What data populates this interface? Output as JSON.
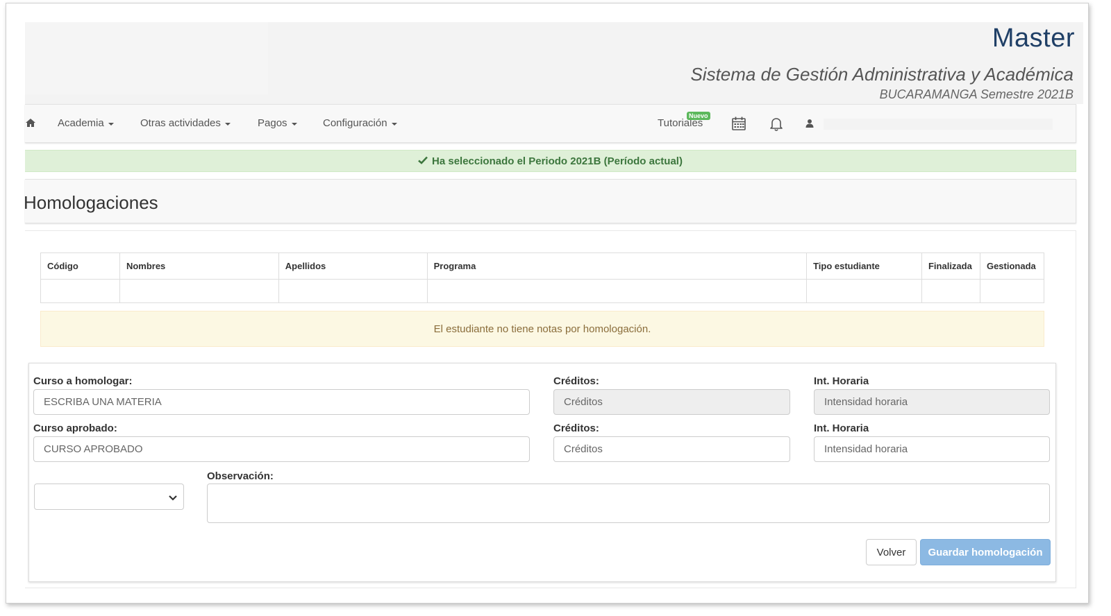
{
  "brand": {
    "title": "Master",
    "subtitle": "Sistema de Gestión Administrativa y Académica",
    "campus": "BUCARAMANGA Semestre 2021B"
  },
  "nav": {
    "home_icon": "home-icon",
    "items": [
      {
        "label": "Academia"
      },
      {
        "label": "Otras actividades"
      },
      {
        "label": "Pagos"
      },
      {
        "label": "Configuración"
      }
    ],
    "tutorials": "Tutoriales",
    "new_badge": "Nuevo",
    "icons": [
      "calendar-icon",
      "bell-icon",
      "user-icon"
    ]
  },
  "alert_success": "Ha seleccionado el Periodo 2021B (Período actual)",
  "page_title": "Homologaciones",
  "table": {
    "headers": [
      "Código",
      "Nombres",
      "Apellidos",
      "Programa",
      "Tipo estudiante",
      "Finalizada",
      "Gestionada"
    ],
    "rows": [
      [
        "",
        "",
        "",
        "",
        "",
        "",
        ""
      ]
    ]
  },
  "alert_warning": "El estudiante no tiene notas por homologación.",
  "form": {
    "curso_homologar_label": "Curso a homologar:",
    "curso_homologar_placeholder": "ESCRIBA UNA MATERIA",
    "creditos1_label": "Créditos:",
    "creditos1_placeholder": "Créditos",
    "int_horaria1_label": "Int. Horaria",
    "int_horaria1_placeholder": "Intensidad horaria",
    "curso_aprobado_label": "Curso aprobado:",
    "curso_aprobado_placeholder": "CURSO APROBADO",
    "creditos2_label": "Créditos:",
    "creditos2_placeholder": "Créditos",
    "int_horaria2_label": "Int. Horaria",
    "int_horaria2_placeholder": "Intensidad horaria",
    "observacion_label": "Observación:",
    "select_value": ""
  },
  "buttons": {
    "volver": "Volver",
    "guardar": "Guardar homologación"
  },
  "colors": {
    "brand": "#1f3f66",
    "success_bg": "#dff0d8",
    "warning_bg": "#fcf8e3",
    "primary": "#8cb9e3"
  }
}
